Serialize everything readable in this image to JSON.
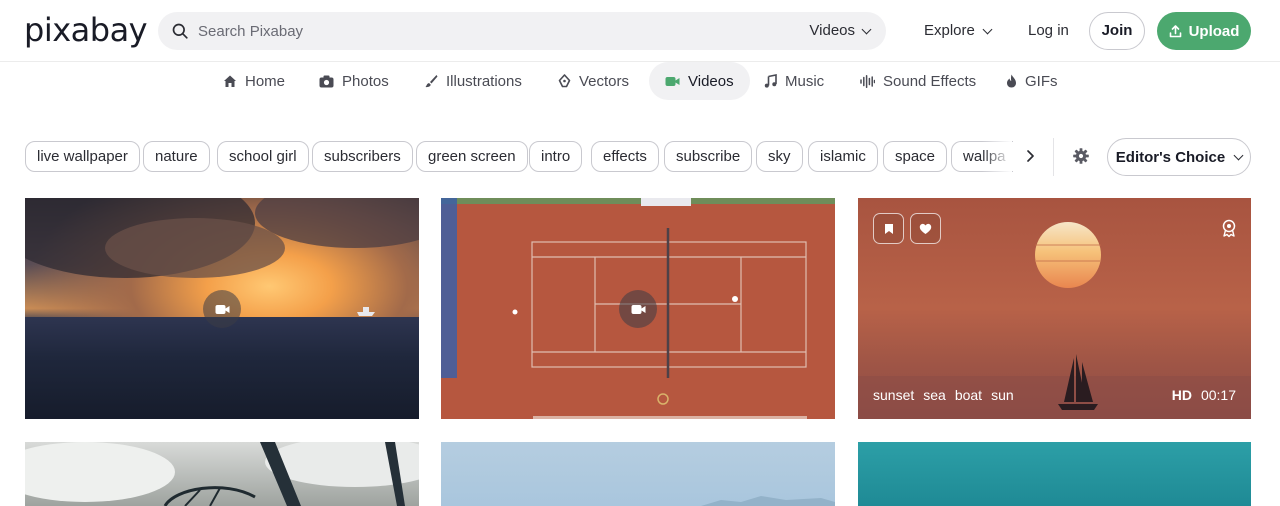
{
  "header": {
    "logo": "pixabay",
    "search_placeholder": "Search Pixabay",
    "search_type": "Videos",
    "explore": "Explore",
    "login": "Log in",
    "join": "Join",
    "upload": "Upload",
    "brand_color": "#4ca86f"
  },
  "categories": [
    {
      "label": "Home",
      "icon": "home-icon"
    },
    {
      "label": "Photos",
      "icon": "camera-icon"
    },
    {
      "label": "Illustrations",
      "icon": "brush-icon"
    },
    {
      "label": "Vectors",
      "icon": "pen-nib-icon"
    },
    {
      "label": "Videos",
      "icon": "video-icon",
      "active": true
    },
    {
      "label": "Music",
      "icon": "music-note-icon"
    },
    {
      "label": "Sound Effects",
      "icon": "waveform-icon"
    },
    {
      "label": "GIFs",
      "icon": "flame-icon"
    }
  ],
  "tags": [
    "live wallpaper",
    "nature",
    "school girl",
    "subscribers",
    "green screen",
    "intro",
    "effects",
    "subscribe",
    "sky",
    "islamic",
    "space",
    "wallpa"
  ],
  "sort": {
    "label": "Editor's Choice"
  },
  "tiles": {
    "featured": {
      "tags": [
        "sunset",
        "sea",
        "boat",
        "sun"
      ],
      "quality": "HD",
      "duration": "00:17"
    }
  }
}
